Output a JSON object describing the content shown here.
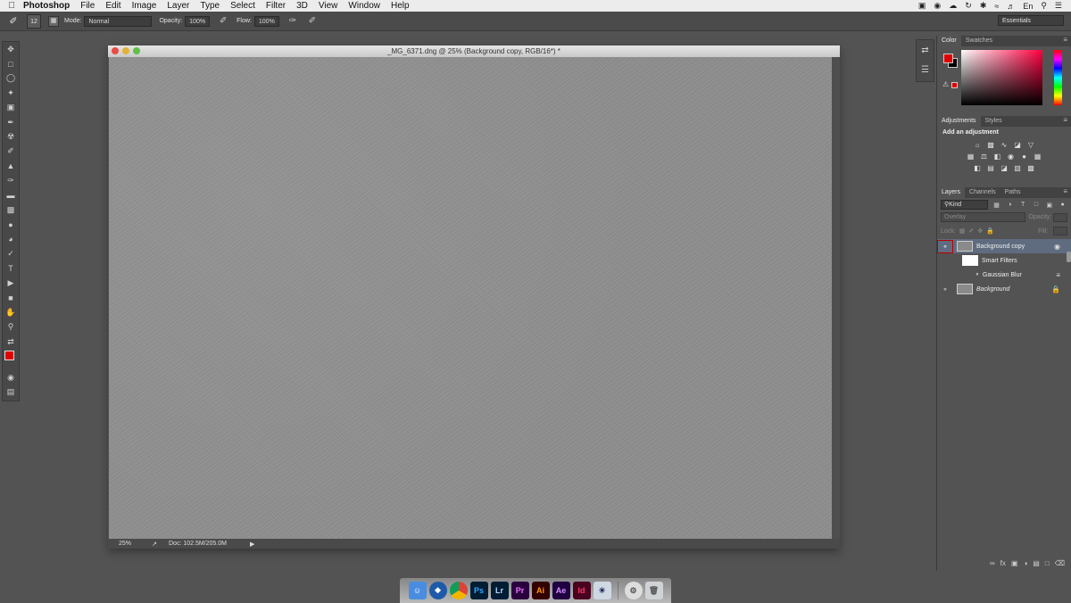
{
  "menubar": {
    "app_name": "Photoshop",
    "items": [
      "File",
      "Edit",
      "Image",
      "Layer",
      "Type",
      "Select",
      "Filter",
      "3D",
      "View",
      "Window",
      "Help"
    ],
    "input_source": "En"
  },
  "options": {
    "brush_size": "12",
    "mode_label": "Mode:",
    "mode_value": "Normal",
    "opacity_label": "Opacity:",
    "opacity_value": "100%",
    "flow_label": "Flow:",
    "flow_value": "100%",
    "workspace": "Essentials"
  },
  "document": {
    "title": "_MG_6371.dng @ 25% (Background copy, RGB/16*) *",
    "zoom": "25%",
    "doc_size": "Doc: 102.5M/205.0M"
  },
  "color_panel": {
    "tabs": [
      "Color",
      "Swatches"
    ],
    "fg_color": "#e00000",
    "bg_color": "#000000"
  },
  "adjustments_panel": {
    "tabs": [
      "Adjustments",
      "Styles"
    ],
    "heading": "Add an adjustment"
  },
  "layers_panel": {
    "tabs": [
      "Layers",
      "Channels",
      "Paths"
    ],
    "kind_filter": "Kind",
    "blend_mode": "Overlay",
    "opacity_label": "Opacity:",
    "lock_label": "Lock:",
    "fill_label": "Fill:",
    "layers": [
      {
        "name": "Background copy",
        "selected": true
      },
      {
        "name": "Smart Filters"
      },
      {
        "name": "Gaussian Blur"
      },
      {
        "name": "Background",
        "locked": true
      }
    ]
  },
  "dock": {
    "apps": [
      "Finder",
      "Safari",
      "Chrome",
      "Ps",
      "Lr",
      "Pr",
      "Ai",
      "Ae",
      "Id",
      "iPhoto",
      "Automator",
      "Trash"
    ]
  }
}
